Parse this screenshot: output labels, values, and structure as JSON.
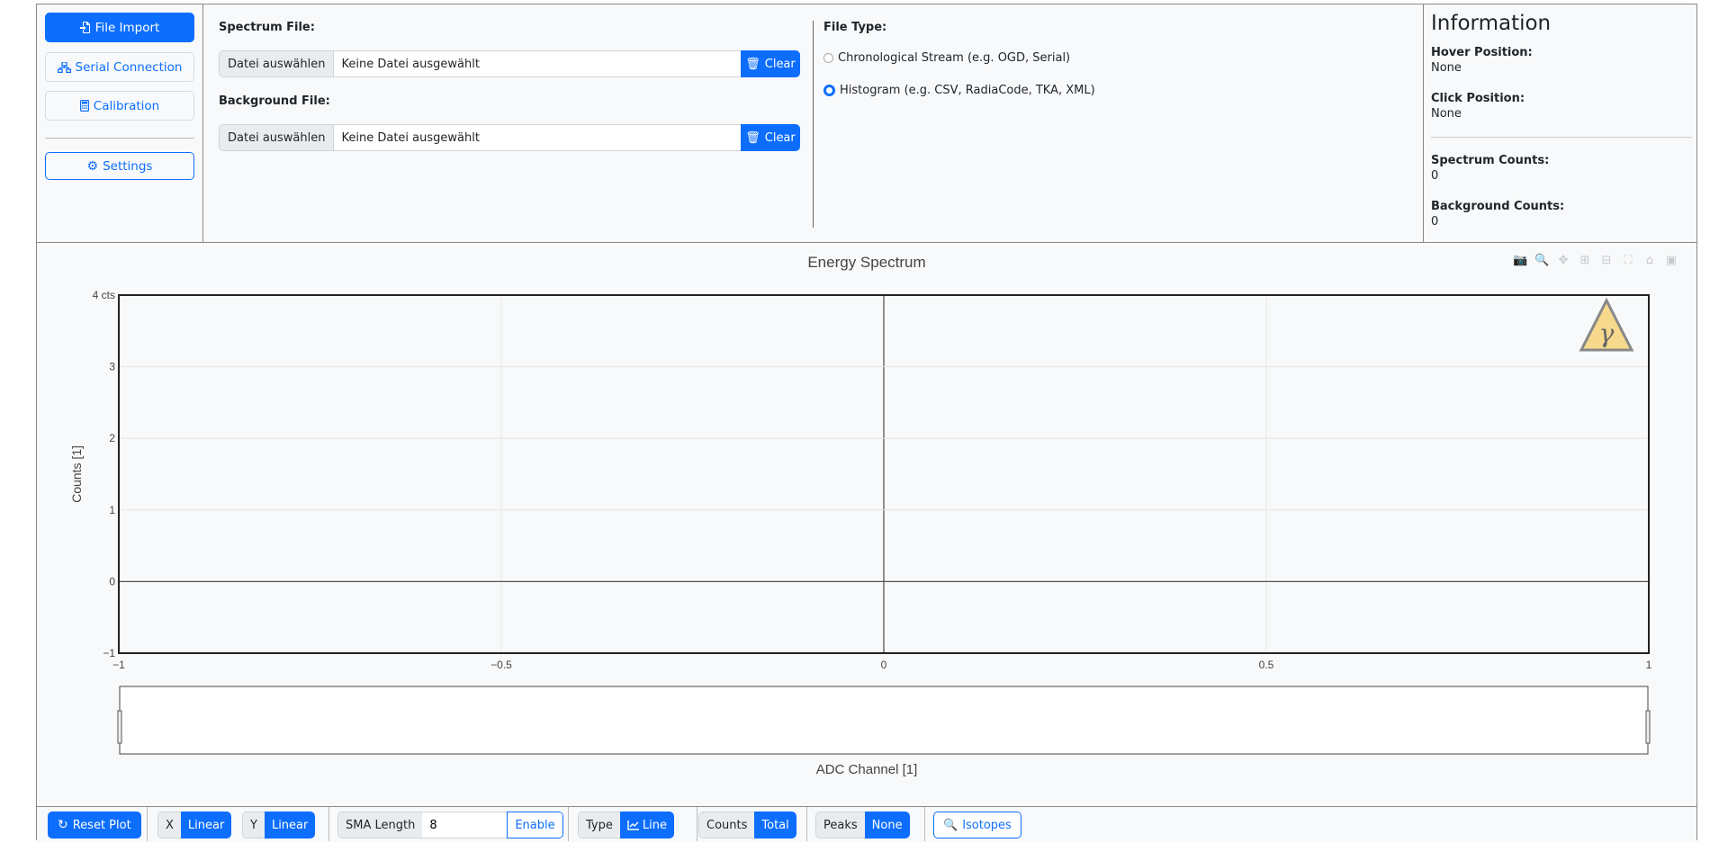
{
  "nav": {
    "file_import": "File Import",
    "serial_connection": "Serial Connection",
    "calibration": "Calibration",
    "settings": "Settings"
  },
  "files": {
    "spectrum_label": "Spectrum File:",
    "background_label": "Background File:",
    "choose_label": "Datei auswählen",
    "no_file": "Keine Datei ausgewählt",
    "clear_label": "Clear"
  },
  "file_type": {
    "label": "File Type:",
    "options": [
      {
        "label": "Chronological Stream (e.g. OGD, Serial)",
        "selected": false
      },
      {
        "label": "Histogram (e.g. CSV, RadiaCode, TKA, XML)",
        "selected": true
      }
    ]
  },
  "info": {
    "title": "Information",
    "hover_label": "Hover Position:",
    "hover_value": "None",
    "click_label": "Click Position:",
    "click_value": "None",
    "spectrum_counts_label": "Spectrum Counts:",
    "spectrum_counts_value": "0",
    "background_counts_label": "Background Counts:",
    "background_counts_value": "0"
  },
  "chart_data": {
    "type": "line",
    "title": "Energy Spectrum",
    "xlabel": "ADC Channel [1]",
    "ylabel": "Counts [1]",
    "xlim": [
      -1,
      1
    ],
    "ylim": [
      -1,
      4
    ],
    "x_ticks": [
      "−1",
      "−0.5",
      "0",
      "0.5",
      "1"
    ],
    "x_tick_values": [
      -1,
      -0.5,
      0,
      0.5,
      1
    ],
    "y_ticks": [
      "−1",
      "0",
      "1",
      "2",
      "3",
      "4 cts"
    ],
    "y_tick_values": [
      -1,
      0,
      1,
      2,
      3,
      4
    ],
    "series": [],
    "grid": true,
    "rangeslider": true,
    "logo_symbol": "γ"
  },
  "toolbar": {
    "reset_plot": "Reset Plot",
    "x_label": "X",
    "x_value": "Linear",
    "y_label": "Y",
    "y_value": "Linear",
    "sma_label": "SMA Length",
    "sma_value": "8",
    "sma_enable": "Enable",
    "type_label": "Type",
    "type_value": "Line",
    "counts_label": "Counts",
    "counts_value": "Total",
    "peaks_label": "Peaks",
    "peaks_value": "None",
    "isotopes": "Isotopes"
  },
  "colors": {
    "primary": "#0d6efd",
    "panel_bg": "#f8f9fa",
    "logo_fill": "#f6d98c",
    "logo_stroke": "#888888"
  }
}
